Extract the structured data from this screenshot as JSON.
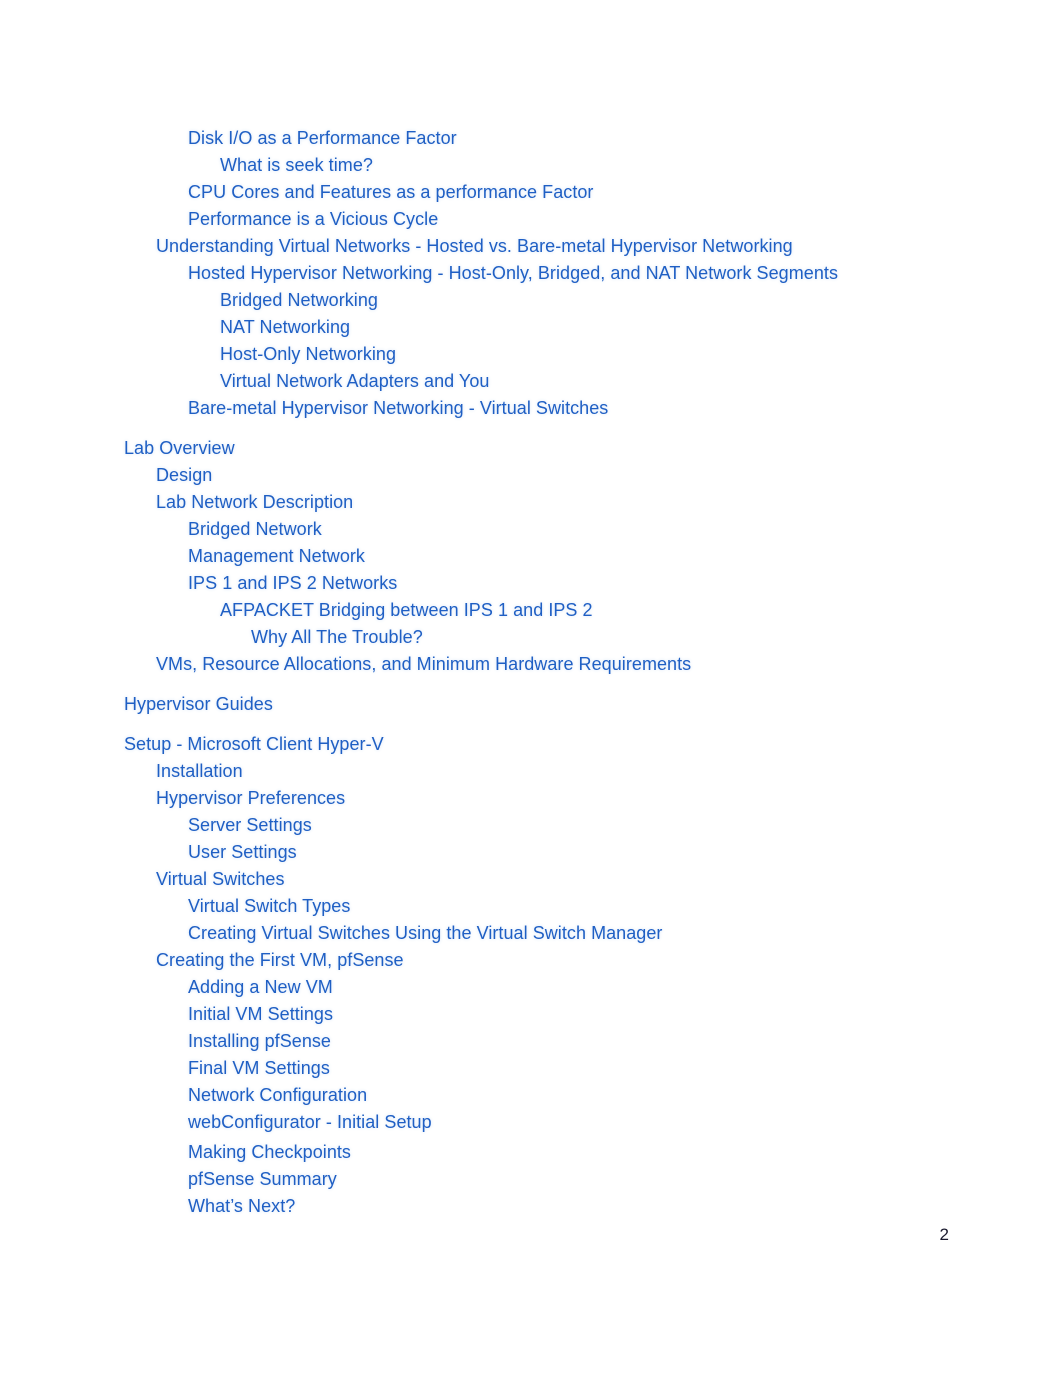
{
  "document": {
    "type": "table-of-contents",
    "page_number": "2",
    "link_color": "#1f5fc4",
    "page_number_color": "#1a1a2e"
  },
  "toc": {
    "entries": [
      {
        "label": "Disk I/O as a Performance Factor",
        "level": 2,
        "gap": "none"
      },
      {
        "label": "What is seek time?",
        "level": 3,
        "gap": "none"
      },
      {
        "label": "CPU Cores and Features as a performance Factor",
        "level": 2,
        "gap": "none"
      },
      {
        "label": "Performance is a Vicious Cycle",
        "level": 2,
        "gap": "none"
      },
      {
        "label": "Understanding Virtual Networks - Hosted vs. Bare-metal Hypervisor Networking",
        "level": 1,
        "gap": "none"
      },
      {
        "label": "Hosted Hypervisor Networking - Host-Only, Bridged, and NAT Network Segments",
        "level": 2,
        "gap": "none"
      },
      {
        "label": "Bridged Networking",
        "level": 3,
        "gap": "none"
      },
      {
        "label": "NAT Networking",
        "level": 3,
        "gap": "none"
      },
      {
        "label": "Host-Only Networking",
        "level": 3,
        "gap": "none"
      },
      {
        "label": "Virtual Network Adapters and You",
        "level": 3,
        "gap": "none"
      },
      {
        "label": "Bare-metal Hypervisor Networking - Virtual Switches",
        "level": 2,
        "gap": "none"
      },
      {
        "label": "Lab Overview",
        "level": 0,
        "gap": "large"
      },
      {
        "label": "Design",
        "level": 1,
        "gap": "none"
      },
      {
        "label": "Lab Network Description",
        "level": 1,
        "gap": "none"
      },
      {
        "label": "Bridged Network",
        "level": 2,
        "gap": "none"
      },
      {
        "label": "Management Network",
        "level": 2,
        "gap": "none"
      },
      {
        "label": "IPS 1 and IPS 2 Networks",
        "level": 2,
        "gap": "none"
      },
      {
        "label": "AFPACKET Bridging between IPS 1 and IPS 2",
        "level": 3,
        "gap": "none"
      },
      {
        "label": "Why All The Trouble?",
        "level": 4,
        "gap": "none"
      },
      {
        "label": "VMs, Resource Allocations, and Minimum Hardware Requirements",
        "level": 1,
        "gap": "none"
      },
      {
        "label": "Hypervisor Guides",
        "level": 0,
        "gap": "large"
      },
      {
        "label": "Setup - Microsoft Client Hyper-V",
        "level": 0,
        "gap": "large"
      },
      {
        "label": "Installation",
        "level": 1,
        "gap": "none"
      },
      {
        "label": "Hypervisor Preferences",
        "level": 1,
        "gap": "none"
      },
      {
        "label": "Server Settings",
        "level": 2,
        "gap": "none"
      },
      {
        "label": "User Settings",
        "level": 2,
        "gap": "none"
      },
      {
        "label": "Virtual Switches",
        "level": 1,
        "gap": "none"
      },
      {
        "label": "Virtual Switch Types",
        "level": 2,
        "gap": "none"
      },
      {
        "label": "Creating Virtual Switches Using the Virtual Switch Manager",
        "level": 2,
        "gap": "none"
      },
      {
        "label": "Creating the First VM, pfSense",
        "level": 1,
        "gap": "none"
      },
      {
        "label": "Adding a New VM",
        "level": 2,
        "gap": "none"
      },
      {
        "label": "Initial VM Settings",
        "level": 2,
        "gap": "none"
      },
      {
        "label": "Installing pfSense",
        "level": 2,
        "gap": "none"
      },
      {
        "label": "Final VM Settings",
        "level": 2,
        "gap": "none"
      },
      {
        "label": "Network Configuration",
        "level": 2,
        "gap": "none"
      },
      {
        "label": "webConfigurator - Initial Setup",
        "level": 2,
        "gap": "none"
      },
      {
        "label": "Making Checkpoints",
        "level": 2,
        "gap": "small"
      },
      {
        "label": "pfSense Summary",
        "level": 2,
        "gap": "none"
      },
      {
        "label": "What’s Next?",
        "level": 2,
        "gap": "none"
      }
    ]
  }
}
